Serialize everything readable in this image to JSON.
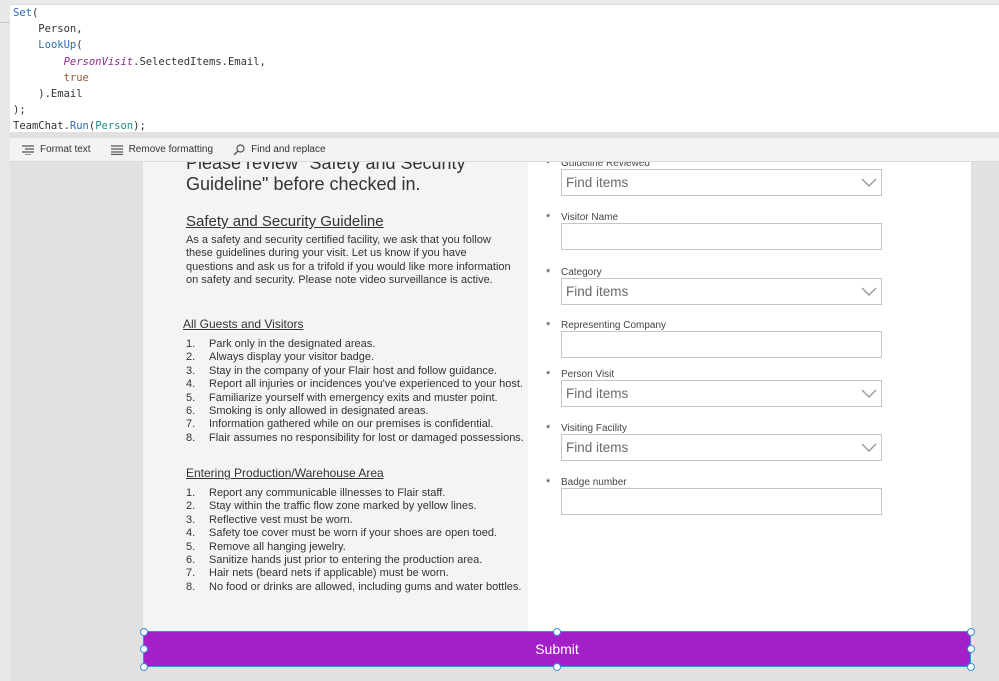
{
  "code_editor": {
    "lines": [
      [
        {
          "t": "Set",
          "c": "kw"
        },
        {
          "t": "(",
          "c": ""
        }
      ],
      [
        {
          "t": "    Person,",
          "c": ""
        }
      ],
      [
        {
          "t": "    ",
          "c": ""
        },
        {
          "t": "LookUp",
          "c": "kw"
        },
        {
          "t": "(",
          "c": ""
        }
      ],
      [
        {
          "t": "        ",
          "c": ""
        },
        {
          "t": "PersonVisit",
          "c": "pv"
        },
        {
          "t": ".SelectedItems.Email,",
          "c": ""
        }
      ],
      [
        {
          "t": "        ",
          "c": ""
        },
        {
          "t": "true",
          "c": "bool"
        }
      ],
      [
        {
          "t": "    ).Email",
          "c": ""
        }
      ],
      [
        {
          "t": ");",
          "c": ""
        }
      ],
      [
        {
          "t": "TeamChat.",
          "c": ""
        },
        {
          "t": "Run",
          "c": "kw"
        },
        {
          "t": "(",
          "c": ""
        },
        {
          "t": "Person",
          "c": "tc"
        },
        {
          "t": ");",
          "c": ""
        }
      ]
    ]
  },
  "toolbar": {
    "format_text": "Format text",
    "remove_formatting": "Remove formatting",
    "find_replace": "Find and replace"
  },
  "left": {
    "heading": "Please review \"Safety and Security Guideline\" before checked in.",
    "section_title": "Safety and Security Guideline",
    "paragraph": "As a safety and security certified facility, we ask that you follow these guidelines during your visit. Let us know if you have questions and ask us for a trifold if you would like more information on safety and security. Please note video surveillance is active.",
    "guests_title": "All Guests and Visitors",
    "guests": [
      {
        "n": "1.",
        "t": "Park only in the designated areas."
      },
      {
        "n": "2.",
        "t": "Always display your visitor badge."
      },
      {
        "n": "3.",
        "t": "Stay in the company of your Flair host and follow guidance."
      },
      {
        "n": "4.",
        "t": "Report all injuries or incidences you've experienced to your host."
      },
      {
        "n": "5.",
        "t": "Familiarize yourself with emergency exits and muster point."
      },
      {
        "n": "6.",
        "t": "Smoking is only allowed in designated areas."
      },
      {
        "n": "7.",
        "t": "Information gathered while on our premises is confidential."
      },
      {
        "n": "8.",
        "t": "Flair assumes no responsibility for lost or damaged possessions."
      }
    ],
    "production_title": "Entering Production/Warehouse Area",
    "production": [
      {
        "n": "1.",
        "t": "Report any communicable illnesses to Flair staff."
      },
      {
        "n": "2.",
        "t": "Stay within the traffic flow zone marked by yellow lines."
      },
      {
        "n": "3.",
        "t": "Reflective vest must be worn."
      },
      {
        "n": "4.",
        "t": "Safety toe cover must be worn if your shoes are open toed."
      },
      {
        "n": "5.",
        "t": "Remove all hanging jewelry."
      },
      {
        "n": "6.",
        "t": "Sanitize hands just prior to entering the production area."
      },
      {
        "n": "7.",
        "t": "Hair nets (beard nets if applicable) must be worn."
      },
      {
        "n": "8.",
        "t": "No food or drinks are allowed, including gums and water bottles."
      }
    ]
  },
  "form": {
    "required_mark": "*",
    "fields": [
      {
        "label": "Guideline Reviewed",
        "type": "combo",
        "placeholder": "Find items",
        "value": ""
      },
      {
        "label": "Visitor Name",
        "type": "text",
        "placeholder": "",
        "value": ""
      },
      {
        "label": "Category",
        "type": "combo",
        "placeholder": "Find items",
        "value": ""
      },
      {
        "label": "Representing Company",
        "type": "text",
        "placeholder": "",
        "value": ""
      },
      {
        "label": "Person Visit",
        "type": "combo",
        "placeholder": "Find items",
        "value": ""
      },
      {
        "label": "Visiting Facility",
        "type": "combo",
        "placeholder": "Find items",
        "value": ""
      },
      {
        "label": "Badge number",
        "type": "text",
        "placeholder": "",
        "value": ""
      }
    ]
  },
  "submit": {
    "label": "Submit",
    "color": "#a31fc8"
  }
}
